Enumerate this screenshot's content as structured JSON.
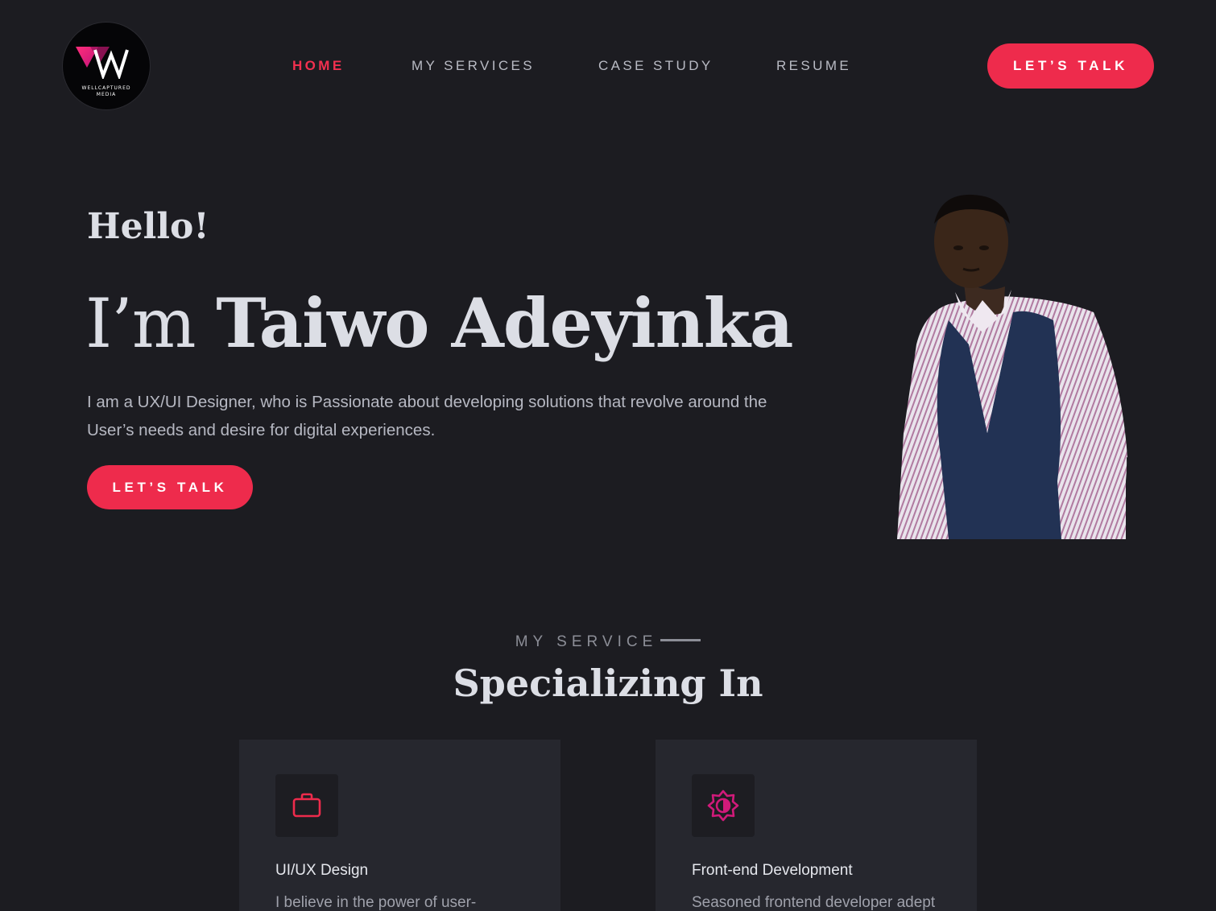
{
  "brand": {
    "logo_text_line1": "WELLCAPTURED",
    "logo_text_line2": "MEDIA"
  },
  "nav": {
    "items": [
      {
        "label": "HOME",
        "active": true
      },
      {
        "label": "MY SERVICES",
        "active": false
      },
      {
        "label": "CASE STUDY",
        "active": false
      },
      {
        "label": "RESUME",
        "active": false
      }
    ],
    "cta_label": "LET’S TALK"
  },
  "hero": {
    "greeting": "Hello!",
    "prefix": "I’m",
    "name": "Taiwo Adeyinka",
    "intro": "I am a UX/UI Designer, who is Passionate about developing solutions that revolve around the User’s needs and desire for digital experiences.",
    "cta_label": "LET’S TALK"
  },
  "services": {
    "eyebrow": "MY SERVICE",
    "title": "Specializing In",
    "cards": [
      {
        "icon": "briefcase-icon",
        "title": "UI/UX Design",
        "description": "I believe in the power of user-"
      },
      {
        "icon": "brightness-icon",
        "title": "Front-end Development",
        "description": "Seasoned frontend developer adept"
      }
    ]
  },
  "colors": {
    "accent": "#ee2b4c",
    "background": "#1c1c21",
    "card": "#26272e",
    "icon_magenta": "#d11a7a"
  }
}
